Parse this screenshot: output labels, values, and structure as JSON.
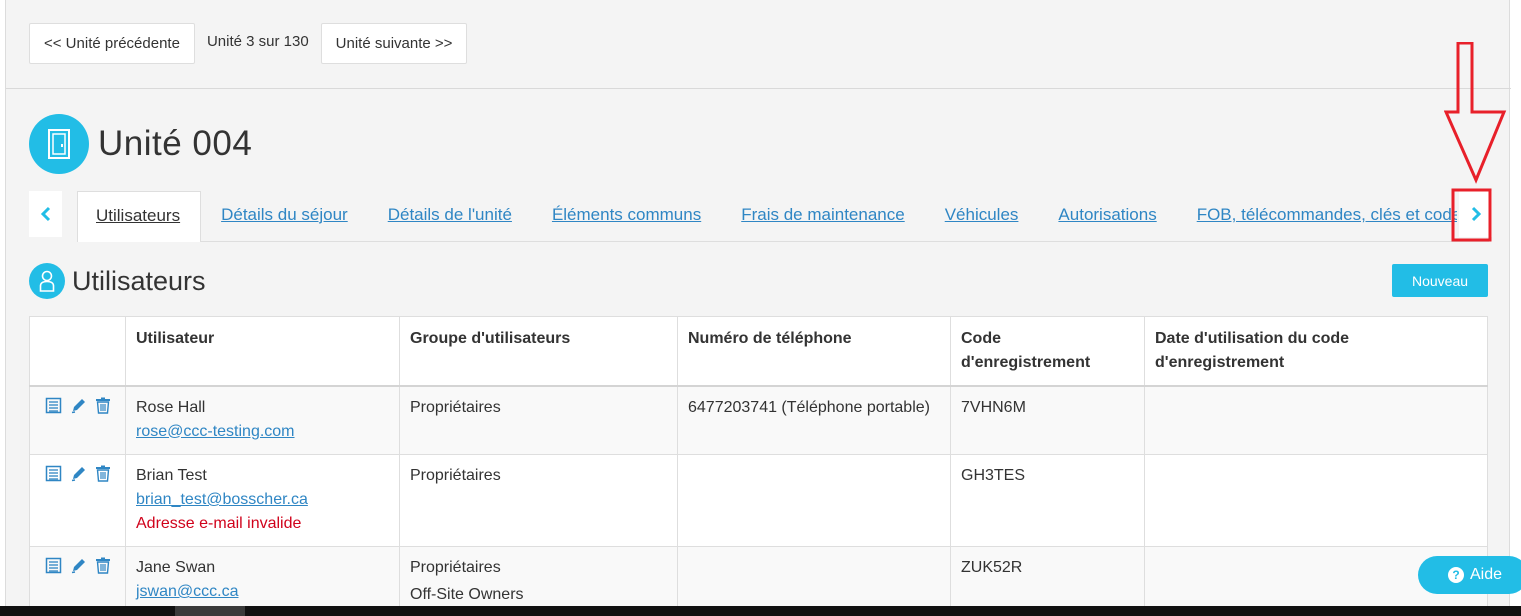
{
  "pager": {
    "prev_label": "<< Unité précédente",
    "status": "Unité 3 sur 130",
    "next_label": "Unité suivante >>"
  },
  "unit": {
    "title": "Unité 004",
    "icon": "door-icon"
  },
  "tabs": [
    {
      "label": "Utilisateurs",
      "active": true
    },
    {
      "label": "Détails du séjour"
    },
    {
      "label": "Détails de l'unité"
    },
    {
      "label": "Éléments communs"
    },
    {
      "label": "Frais de maintenance"
    },
    {
      "label": "Véhicules"
    },
    {
      "label": "Autorisations"
    },
    {
      "label": "FOB, télécommandes, clés et codes"
    }
  ],
  "section": {
    "title": "Utilisateurs",
    "icon": "user-icon",
    "new_label": "Nouveau"
  },
  "table": {
    "headers": [
      "",
      "Utilisateur",
      "Groupe d'utilisateurs",
      "Numéro de téléphone",
      "Code d'enregistrement",
      "Date d'utilisation du code d'enregistrement"
    ],
    "rows": [
      {
        "name": "Rose Hall",
        "email": "rose@ccc-testing.com",
        "warning": "",
        "group": "Propriétaires",
        "group2": "",
        "phone": "6477203741 (Téléphone portable)",
        "code": "7VHN6M",
        "date": ""
      },
      {
        "name": "Brian Test",
        "email": "brian_test@bosscher.ca",
        "warning": "Adresse e-mail invalide",
        "group": "Propriétaires",
        "group2": "",
        "phone": "",
        "code": "GH3TES",
        "date": ""
      },
      {
        "name": "Jane Swan",
        "email": "jswan@ccc.ca",
        "warning": "",
        "group": "Propriétaires",
        "group2": "Off-Site Owners",
        "phone": "",
        "code": "ZUK52R",
        "date": ""
      }
    ]
  },
  "help": {
    "label": "Aide"
  },
  "colors": {
    "accent": "#22bde6",
    "link": "#2f86c4",
    "error": "#d0021b",
    "annotation": "#e8202a"
  }
}
